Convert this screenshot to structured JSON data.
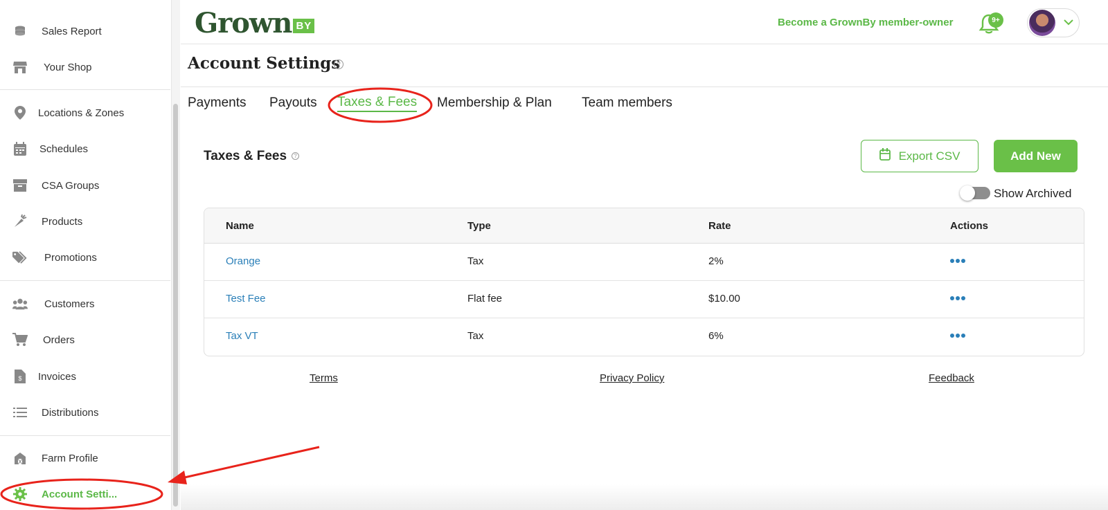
{
  "sidebar": {
    "items": [
      {
        "label": "Sales Report",
        "icon": "coins-icon"
      },
      {
        "label": "Your Shop",
        "icon": "shop-icon"
      },
      {
        "label": "Locations & Zones",
        "icon": "map-pin-icon"
      },
      {
        "label": "Schedules",
        "icon": "calendar-icon"
      },
      {
        "label": "CSA Groups",
        "icon": "box-icon"
      },
      {
        "label": "Products",
        "icon": "carrot-icon"
      },
      {
        "label": "Promotions",
        "icon": "tags-icon"
      },
      {
        "label": "Customers",
        "icon": "users-icon"
      },
      {
        "label": "Orders",
        "icon": "cart-icon"
      },
      {
        "label": "Invoices",
        "icon": "invoice-icon"
      },
      {
        "label": "Distributions",
        "icon": "list-icon"
      },
      {
        "label": "Farm Profile",
        "icon": "farm-icon"
      },
      {
        "label": "Account Setti...",
        "icon": "gear-icon",
        "active": true
      }
    ]
  },
  "header": {
    "logo_text": "Grown",
    "logo_badge": "BY",
    "member_link": "Become a GrownBy member-owner",
    "notification_badge": "9+"
  },
  "page": {
    "title": "Account Settings",
    "help": "?"
  },
  "tabs": [
    {
      "label": "Payments"
    },
    {
      "label": "Payouts"
    },
    {
      "label": "Taxes & Fees",
      "active": true
    },
    {
      "label": "Membership & Plan"
    },
    {
      "label": "Team members"
    }
  ],
  "section": {
    "title": "Taxes & Fees",
    "help": "?",
    "export_label": "Export CSV",
    "add_label": "Add New",
    "toggle_label": "Show Archived",
    "toggle_on": false
  },
  "table": {
    "columns": [
      "Name",
      "Type",
      "Rate",
      "Actions"
    ],
    "rows": [
      {
        "name": "Orange",
        "type": "Tax",
        "rate": "2%"
      },
      {
        "name": "Test Fee",
        "type": "Flat fee",
        "rate": "$10.00"
      },
      {
        "name": "Tax VT",
        "type": "Tax",
        "rate": "6%"
      }
    ]
  },
  "footer": {
    "terms": "Terms",
    "privacy": "Privacy Policy",
    "feedback": "Feedback"
  },
  "colors": {
    "brand_green": "#6ac048",
    "brand_dark": "#2f5530",
    "link_blue": "#2a7fb8",
    "annotation_red": "#e8231b"
  }
}
